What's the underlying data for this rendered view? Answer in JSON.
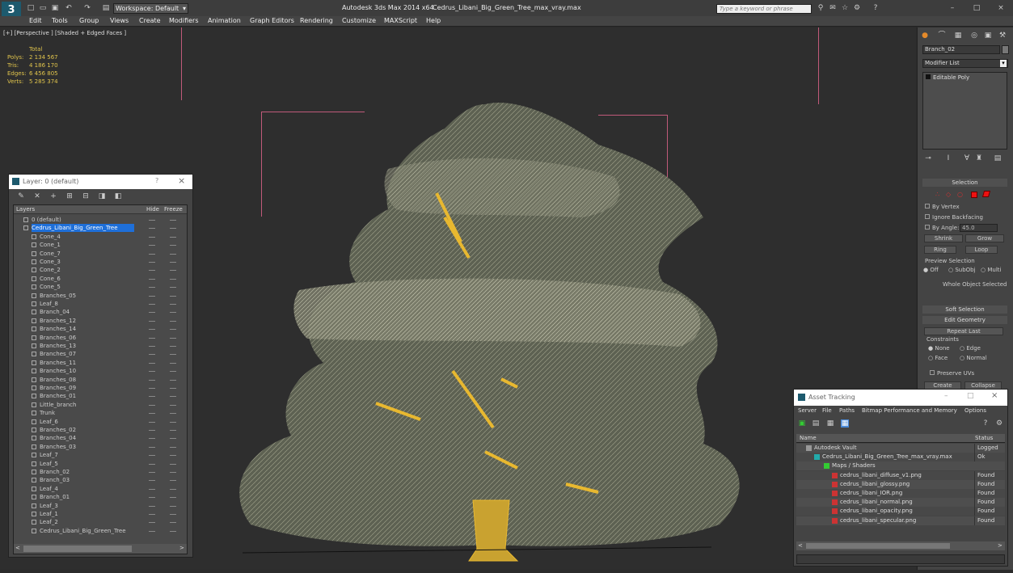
{
  "titlebar": {
    "app_title": "Autodesk 3ds Max  2014 x64",
    "file_title": "Cedrus_Libani_Big_Green_Tree_max_vray.max",
    "workspace": "Workspace: Default",
    "search_placeholder": "Type a keyword or phrase"
  },
  "menu": [
    "Edit",
    "Tools",
    "Group",
    "Views",
    "Create",
    "Modifiers",
    "Animation",
    "Graph Editors",
    "Rendering",
    "Customize",
    "MAXScript",
    "Help"
  ],
  "viewport": {
    "label": "[+] [Perspective ] [Shaded + Edged Faces ]",
    "stats_header": "Total",
    "stats": [
      {
        "label": "Polys:",
        "value": "2 134 567"
      },
      {
        "label": "Tris:",
        "value": "4 186 170"
      },
      {
        "label": "Edges:",
        "value": "6 456 805"
      },
      {
        "label": "Verts:",
        "value": "5 285 374"
      }
    ]
  },
  "layer_window": {
    "title": "Layer: 0 (default)",
    "help": "?",
    "close": "×",
    "col_layers": "Layers",
    "col_hide": "Hide",
    "col_freeze": "Freeze",
    "rows": [
      "0 (default)",
      "Cedrus_Libani_Big_Green_Tree",
      "Cone_4",
      "Cone_1",
      "Cone_7",
      "Cone_3",
      "Cone_2",
      "Cone_6",
      "Cone_5",
      "Branches_05",
      "Leaf_8",
      "Branch_04",
      "Branches_12",
      "Branches_14",
      "Branches_06",
      "Branches_13",
      "Branches_07",
      "Branches_11",
      "Branches_10",
      "Branches_08",
      "Branches_09",
      "Branches_01",
      "Little_branch",
      "Trunk",
      "Leaf_6",
      "Branches_02",
      "Branches_04",
      "Branches_03",
      "Leaf_7",
      "Leaf_5",
      "Branch_02",
      "Branch_03",
      "Leaf_4",
      "Branch_01",
      "Leaf_3",
      "Leaf_1",
      "Leaf_2",
      "Cedrus_Libani_Big_Green_Tree"
    ]
  },
  "command_panel": {
    "object_name": "Branch_02",
    "modifier_list": "Modifier List",
    "stack_item": "Editable Poly",
    "selection_title": "Selection",
    "by_vertex": "By Vertex",
    "ignore_backfacing": "Ignore Backfacing",
    "by_angle": "By Angle:",
    "angle_value": "45.0",
    "shrink": "Shrink",
    "grow": "Grow",
    "ring": "Ring",
    "loop": "Loop",
    "preview_selection": "Preview Selection",
    "off": "Off",
    "subobj": "SubObj",
    "multi": "Multi",
    "whole_object": "Whole Object Selected",
    "soft_selection": "Soft Selection",
    "edit_geometry": "Edit Geometry",
    "repeat_last": "Repeat Last",
    "constraints": "Constraints",
    "none": "None",
    "edge": "Edge",
    "face": "Face",
    "normal": "Normal",
    "preserve_uvs": "Preserve UVs",
    "create": "Create",
    "collapse": "Collapse"
  },
  "asset_tracking": {
    "title": "Asset Tracking",
    "menu": [
      "Server",
      "File",
      "Paths",
      "Bitmap Performance and Memory",
      "Options"
    ],
    "col_name": "Name",
    "col_status": "Status",
    "rows": [
      {
        "name": "Autodesk Vault",
        "status": "Logged Ou"
      },
      {
        "name": "Cedrus_Libani_Big_Green_Tree_max_vray.max",
        "status": "Ok"
      },
      {
        "name": "Maps / Shaders",
        "status": ""
      },
      {
        "name": "cedrus_libani_diffuse_v1.png",
        "status": "Found"
      },
      {
        "name": "cedrus_libani_glossy.png",
        "status": "Found"
      },
      {
        "name": "cedrus_libani_IOR.png",
        "status": "Found"
      },
      {
        "name": "cedrus_libani_normal.png",
        "status": "Found"
      },
      {
        "name": "cedrus_libani_opacity.png",
        "status": "Found"
      },
      {
        "name": "cedrus_libani_specular.png",
        "status": "Found"
      }
    ]
  },
  "colors": {
    "accent": "#1e6fd9",
    "stats": "#e0c44c",
    "foliage": "#6e7060",
    "wire": "#e8b830"
  }
}
